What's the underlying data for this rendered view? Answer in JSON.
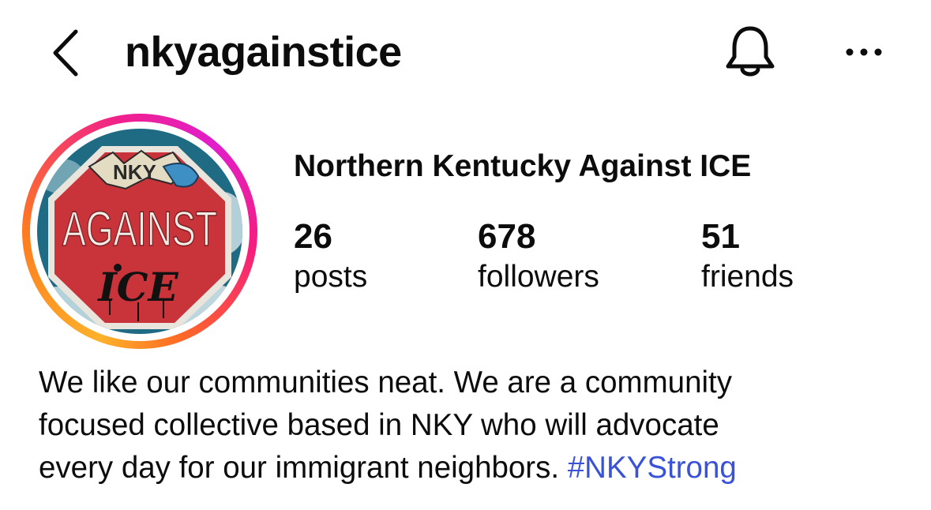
{
  "header": {
    "username": "nkyagainstice",
    "back_icon": "chevron-left-icon",
    "notification_icon": "bell-icon",
    "more_icon": "more-horizontal-icon"
  },
  "profile": {
    "display_name": "Northern Kentucky Against ICE",
    "avatar": {
      "sign_text": "AGAINST",
      "graffiti_top": "NKY",
      "graffiti_bottom": "ICE"
    },
    "stats": [
      {
        "value": "26",
        "label": "posts"
      },
      {
        "value": "678",
        "label": "followers"
      },
      {
        "value": "51",
        "label": "friends"
      }
    ],
    "bio": {
      "line1": "We like our communities neat. We are a community",
      "line2": "focused collective based in NKY who will advocate",
      "line3_text": "every day for our immigrant neighbors. ",
      "hashtag": "#NKYStrong"
    }
  },
  "colors": {
    "hashtag": "#3a52d8",
    "text": "#0c0c0c",
    "story_ring_start": "#fdb22a",
    "story_ring_end": "#e11fcb"
  }
}
